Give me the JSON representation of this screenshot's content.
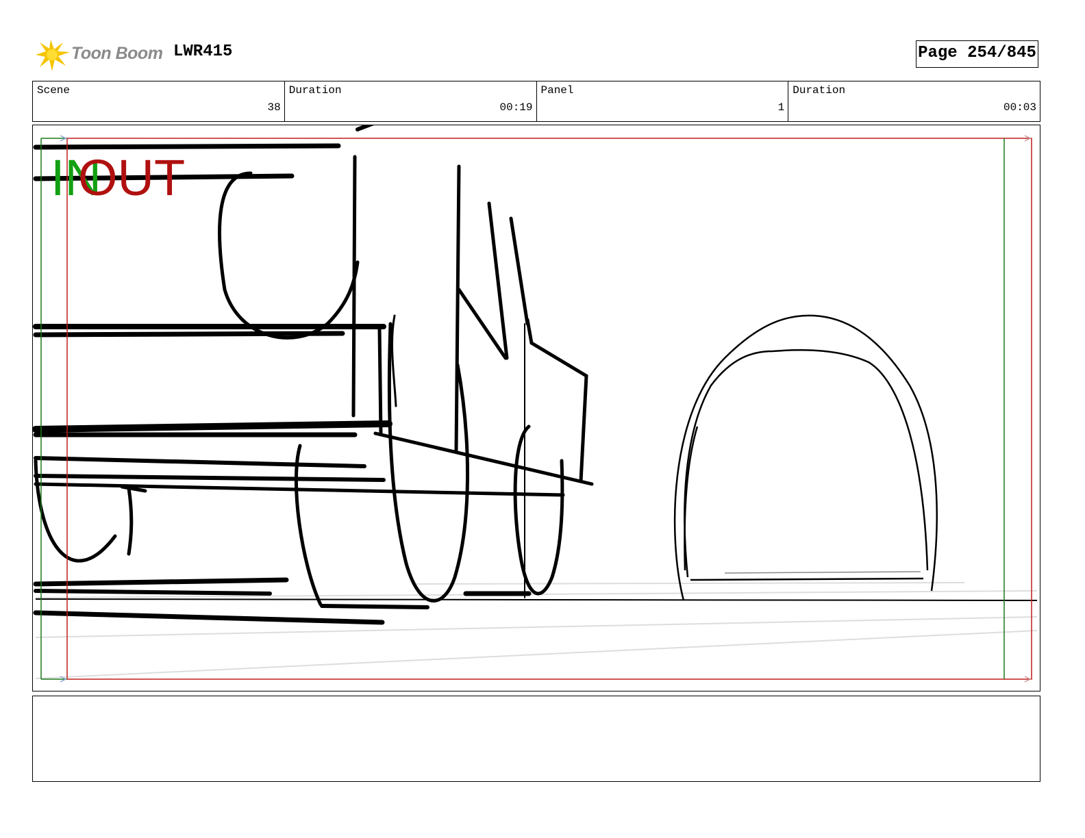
{
  "header": {
    "brand": "Toon Boom",
    "logo_icon": "toon-boom-sunburst-icon",
    "project_code": "LWR415",
    "page_label": "Page 254/845"
  },
  "info": {
    "scene_label": "Scene",
    "scene_value": "38",
    "scene_duration_label": "Duration",
    "scene_duration_value": "00:19",
    "panel_label": "Panel",
    "panel_value": "1",
    "panel_duration_label": "Duration",
    "panel_duration_value": "00:03"
  },
  "panel": {
    "in_marker": "IN",
    "out_marker": "OUT",
    "in_color": "#12a012",
    "out_color": "#b01010"
  },
  "notes": {
    "text": ""
  }
}
